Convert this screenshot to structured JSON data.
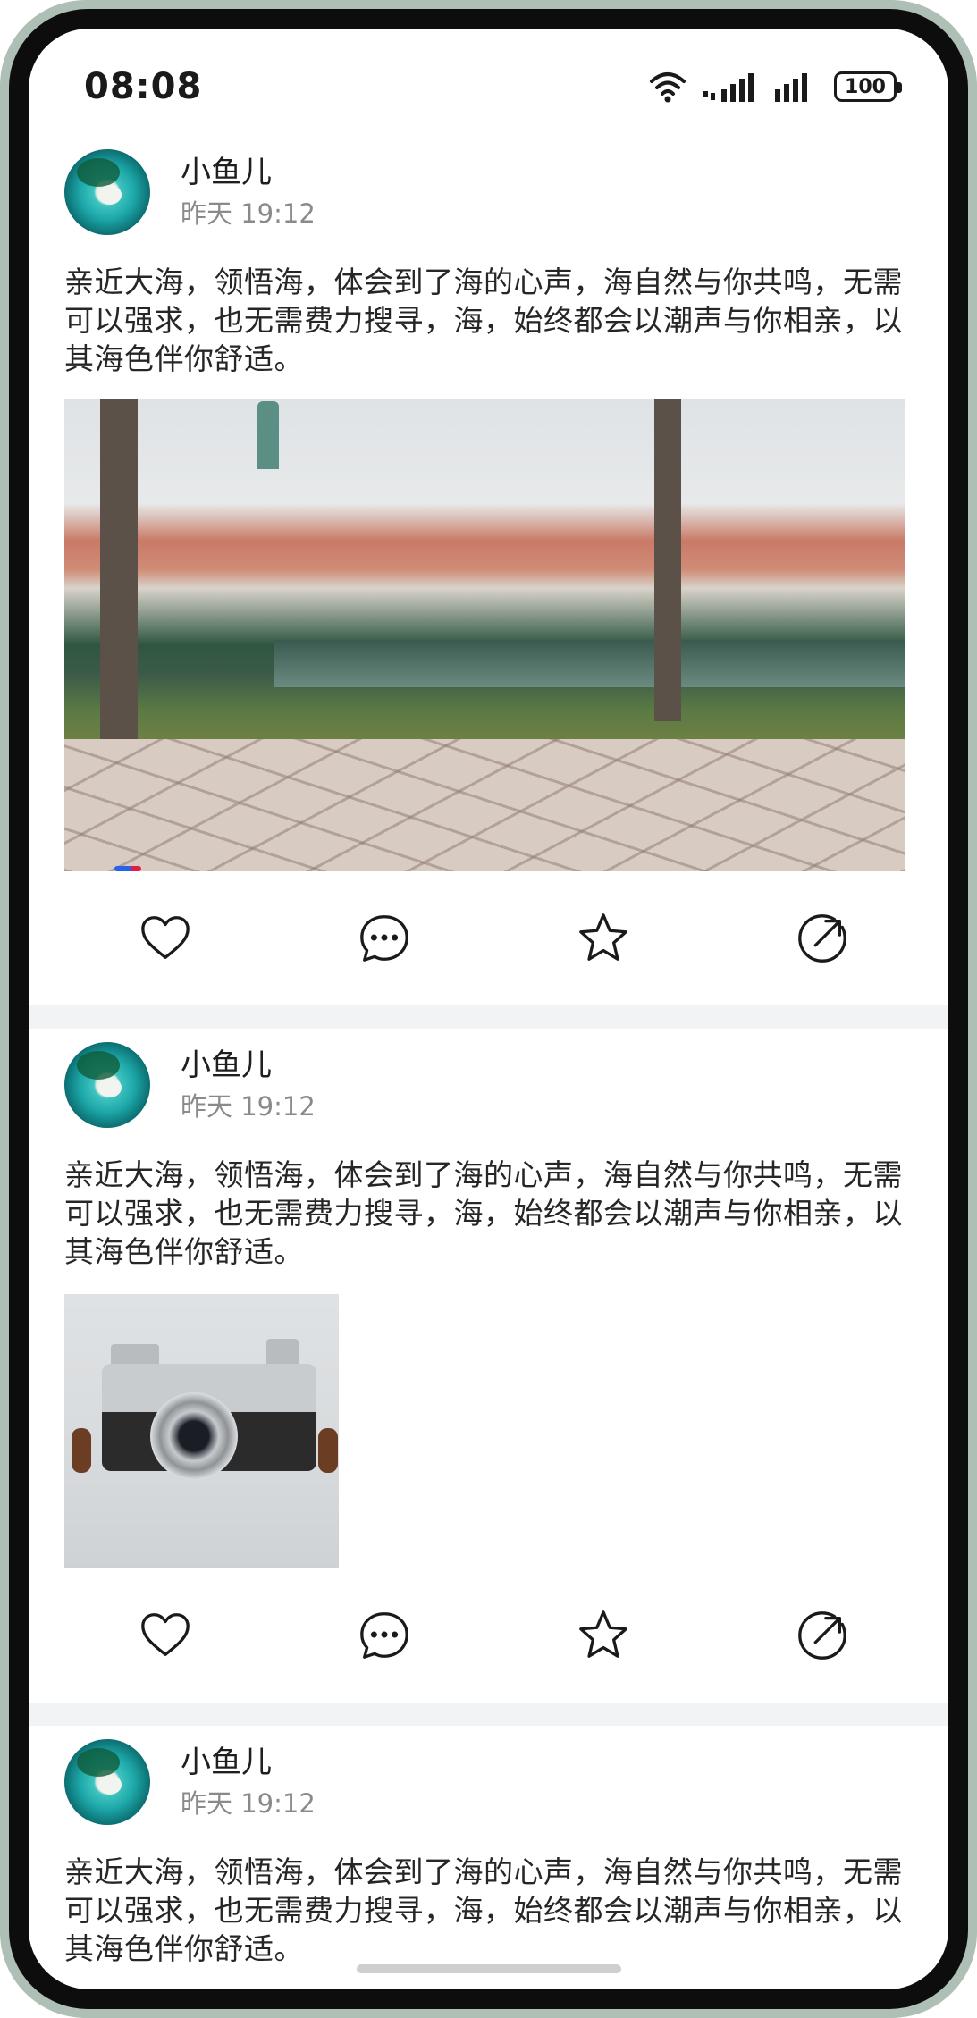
{
  "status_bar": {
    "time": "08:08",
    "battery": "100",
    "icons": [
      "wifi-icon",
      "signal-icon",
      "signal-icon",
      "battery-icon"
    ]
  },
  "feed": {
    "posts": [
      {
        "user_name": "小鱼儿",
        "time": "昨天 19:12",
        "text": "亲近大海，领悟海，体会到了海的心声，海自然与你共鸣，无需可以强求，也无需费力搜寻，海，始终都会以潮声与你相亲，以其海色伴你舒适。",
        "media": "video"
      },
      {
        "user_name": "小鱼儿",
        "time": "昨天 19:12",
        "text": "亲近大海，领悟海，体会到了海的心声，海自然与你共鸣，无需可以强求，也无需费力搜寻，海，始终都会以潮声与你相亲，以其海色伴你舒适。",
        "media": "image"
      },
      {
        "user_name": "小鱼儿",
        "time": "昨天 19:12",
        "text": "亲近大海，领悟海，体会到了海的心声，海自然与你共鸣，无需可以强求，也无需费力搜寻，海，始终都会以潮声与你相亲，以其海色伴你舒适。"
      }
    ],
    "actions": [
      "heart-icon",
      "comment-icon",
      "star-icon",
      "share-icon"
    ]
  },
  "colors": {
    "divider": "#f1f3f5",
    "primary_text": "#262626",
    "secondary_text": "#8a8a8a",
    "progress_blue": "#2563eb",
    "progress_red": "#e11d48"
  }
}
